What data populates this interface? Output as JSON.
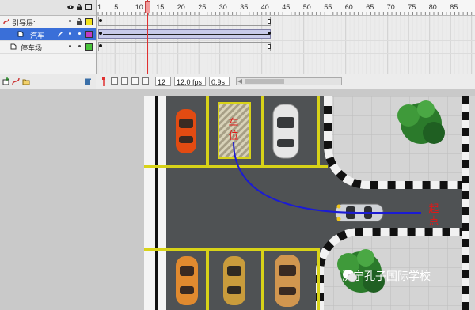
{
  "timeline": {
    "layers": [
      {
        "name": "引导层: ...",
        "color": "#f2e31c",
        "selected": false
      },
      {
        "name": "汽车",
        "color": "#c13bc4",
        "selected": true
      },
      {
        "name": "停车场",
        "color": "#48c43b",
        "selected": false
      }
    ],
    "ruler_ticks": [
      "1",
      "5",
      "10",
      "15",
      "20",
      "25",
      "30",
      "35",
      "40",
      "45",
      "50",
      "55",
      "60",
      "65",
      "70",
      "75",
      "80",
      "85"
    ],
    "current_frame": "12",
    "fps": "12.0 fps",
    "elapsed": "0.9s"
  },
  "stage": {
    "label_start": [
      "车",
      "位"
    ],
    "label_end": [
      "起",
      "点"
    ],
    "path_color": "#1b1bd4"
  },
  "watermark": {
    "text": "济宁孔子国际学校"
  }
}
